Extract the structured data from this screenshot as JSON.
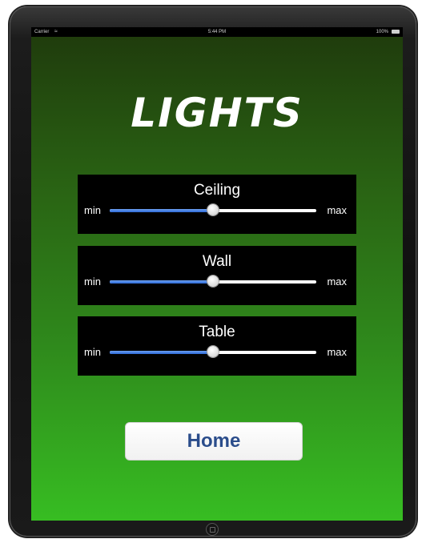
{
  "status_bar": {
    "carrier": "Carrier",
    "wifi_icon": "wifi-icon",
    "time": "5:44 PM",
    "battery": "100%",
    "battery_icon": "battery-icon"
  },
  "title": "LIGHTS",
  "sliders": [
    {
      "label": "Ceiling",
      "min_label": "min",
      "max_label": "max",
      "value": 0.5
    },
    {
      "label": "Wall",
      "min_label": "min",
      "max_label": "max",
      "value": 0.5
    },
    {
      "label": "Table",
      "min_label": "min",
      "max_label": "max",
      "value": 0.5
    }
  ],
  "home_button": {
    "label": "Home"
  },
  "colors": {
    "slider_fill": "#2d6ad8",
    "button_text": "#2b4d8b",
    "background_top": "#1f3a0c",
    "background_bottom": "#37bd22"
  }
}
